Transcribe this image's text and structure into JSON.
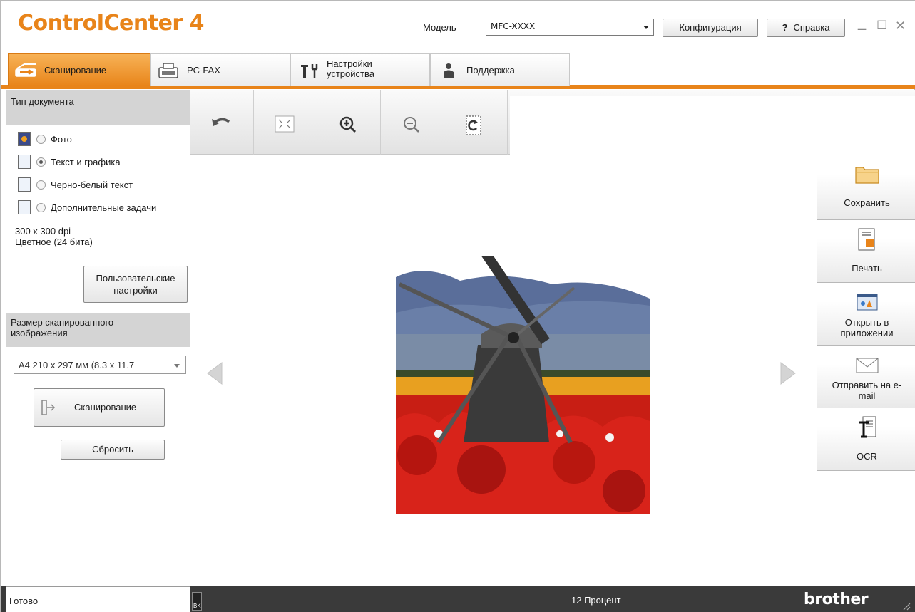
{
  "app": {
    "logo": "ControlCenter 4",
    "model_label": "Модель",
    "model_value": "MFC-XXXX",
    "config_label": "Конфигурация",
    "help_mark": "?",
    "help_label": "Справка",
    "window_controls": [
      "_",
      "☐",
      "✕"
    ]
  },
  "tabs": [
    {
      "label": "Сканирование",
      "icon": "scanner-icon",
      "active": true
    },
    {
      "label": "PC-FAX",
      "icon": "fax-icon",
      "active": false
    },
    {
      "label": "Настройки устройства",
      "icon": "tools-icon",
      "active": false
    },
    {
      "label": "Поддержка",
      "icon": "person-icon",
      "active": false
    }
  ],
  "left_panel": {
    "doctype_title": "Тип документа",
    "doc_types": [
      {
        "label": "Фото",
        "selected": false
      },
      {
        "label": "Текст и графика",
        "selected": true
      },
      {
        "label": "Черно-белый текст",
        "selected": false
      },
      {
        "label": "Дополнительные задачи",
        "selected": false
      }
    ],
    "resolution": "300 x 300  dpi",
    "color_mode": "Цветное (24 бита)",
    "custom_label_1": "Пользовательские",
    "custom_label_2": "настройки",
    "size_title": "Размер сканированного изображения",
    "size_value": "A4 210 x 297 мм (8.3 x 11.7",
    "scan_label": "Сканирование",
    "reset_label": "Сбросить"
  },
  "toolbar": [
    "undo-icon",
    "fit-to-window-icon",
    "zoom-in-icon",
    "zoom-out-icon",
    "rotate-icon"
  ],
  "actions": [
    {
      "label": "Сохранить",
      "icon": "folder-icon"
    },
    {
      "label": "Печать",
      "icon": "print-icon"
    },
    {
      "label": "Открыть в приложении",
      "icon": "app-window-icon"
    },
    {
      "label": "Отправить на e-mail",
      "icon": "envelope-icon"
    },
    {
      "label": "OCR",
      "icon": "ocr-icon"
    }
  ],
  "status": {
    "text": "Готово",
    "ink_label": "BK",
    "zoom": "12 Процент",
    "brand": "brother"
  },
  "colors": {
    "accent": "#e8841a",
    "header_gray": "#d4d4d4",
    "status_dark": "#3a3a3a"
  }
}
